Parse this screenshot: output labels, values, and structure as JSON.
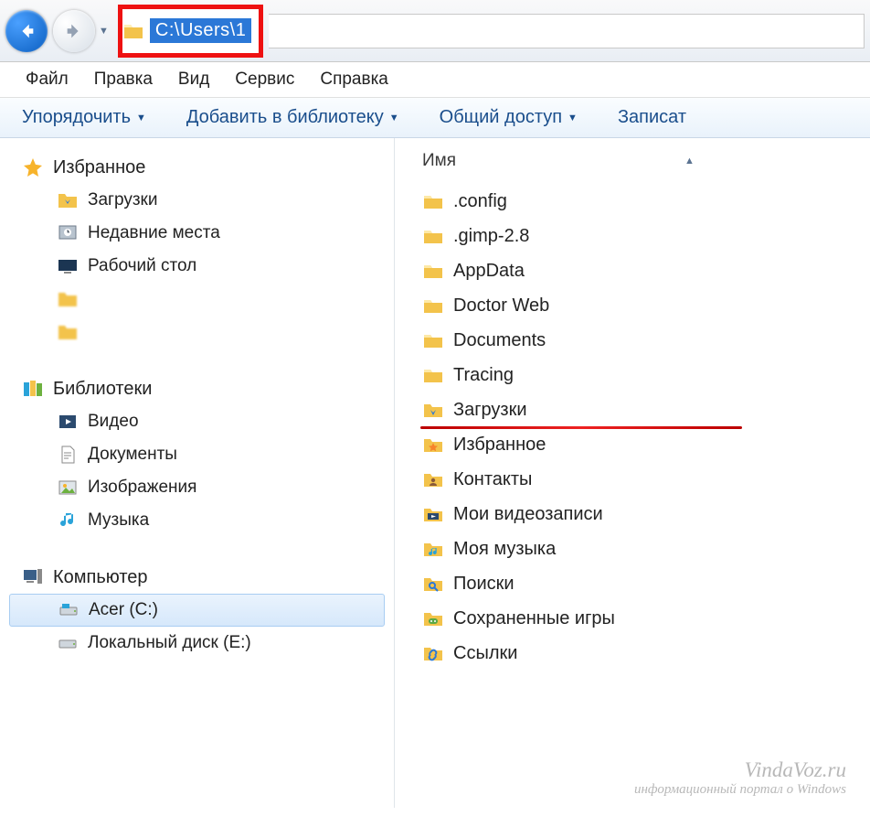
{
  "address": {
    "path": "C:\\Users\\1"
  },
  "menu": {
    "file": "Файл",
    "edit": "Правка",
    "view": "Вид",
    "tools": "Сервис",
    "help": "Справка"
  },
  "toolbar": {
    "organize": "Упорядочить",
    "add_to_library": "Добавить в библиотеку",
    "share": "Общий доступ",
    "burn": "Записат"
  },
  "columns": {
    "name": "Имя"
  },
  "nav": {
    "favorites": {
      "header": "Избранное",
      "downloads": "Загрузки",
      "recent": "Недавние места",
      "desktop": "Рабочий стол"
    },
    "libraries": {
      "header": "Библиотеки",
      "video": "Видео",
      "documents": "Документы",
      "pictures": "Изображения",
      "music": "Музыка"
    },
    "computer": {
      "header": "Компьютер",
      "drive_c": "Acer (C:)",
      "drive_e": "Локальный диск (E:)"
    }
  },
  "files": [
    {
      "label": ".config",
      "icon": "folder"
    },
    {
      "label": ".gimp-2.8",
      "icon": "folder"
    },
    {
      "label": "AppData",
      "icon": "folder"
    },
    {
      "label": "Doctor Web",
      "icon": "folder"
    },
    {
      "label": "Documents",
      "icon": "folder"
    },
    {
      "label": "Tracing",
      "icon": "folder"
    },
    {
      "label": "Загрузки",
      "icon": "downloads",
      "highlight": true
    },
    {
      "label": "Избранное",
      "icon": "favorites"
    },
    {
      "label": "Контакты",
      "icon": "contacts"
    },
    {
      "label": "Мои видеозаписи",
      "icon": "video"
    },
    {
      "label": "Моя музыка",
      "icon": "music-folder"
    },
    {
      "label": "Поиски",
      "icon": "search-folder"
    },
    {
      "label": "Сохраненные игры",
      "icon": "games"
    },
    {
      "label": "Ссылки",
      "icon": "links"
    }
  ],
  "watermark": {
    "site": "VindaVoz.ru",
    "tagline": "информационный портал о Windows"
  }
}
